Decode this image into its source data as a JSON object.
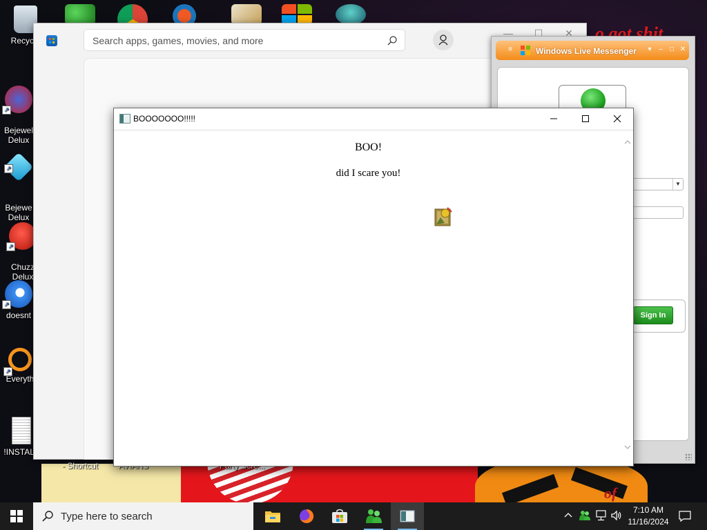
{
  "desktop": {
    "icons": [
      {
        "label": "Recycle",
        "icon": "recycle-bin-icon"
      },
      {
        "label": "Bejewel\nDelux",
        "icon": "bejeweled-2-icon"
      },
      {
        "label": "Bejewe\nDelux",
        "icon": "bejeweled-3-icon"
      },
      {
        "label": "Chuzz\nDelux",
        "icon": "chuzzle-icon"
      },
      {
        "label": "doesnt",
        "icon": "thunderbird-icon"
      },
      {
        "label": "Everyth",
        "icon": "everything-search-icon"
      },
      {
        "label": "!INSTALL",
        "icon": "text-document-icon"
      }
    ],
    "overlay_labels": [
      "- Shortcut",
      "AVIANS",
      "Party Scre..."
    ],
    "wallpaper_text": [
      "o got shit",
      "of"
    ]
  },
  "store": {
    "search_placeholder": "Search apps, games, movies, and more"
  },
  "messenger": {
    "title": "Windows Live Messenger",
    "sign_in_label": "Sign In",
    "status_color": "#1ba51b"
  },
  "boo_window": {
    "title": "BOOOOOOO!!!!!",
    "heading": "BOO!",
    "subtext": "did I scare you!"
  },
  "taskbar": {
    "search_placeholder": "Type here to search",
    "apps": [
      "file-explorer-icon",
      "firefox-icon",
      "microsoft-store-icon",
      "windows-live-messenger-icon",
      "hta-window-icon"
    ],
    "time": "7:10 AM",
    "date": "11/16/2024"
  },
  "colors": {
    "taskbar_bg": "#1c1c1c",
    "messenger_orange": "#f38b19",
    "accent_blue": "#76b9ed"
  }
}
